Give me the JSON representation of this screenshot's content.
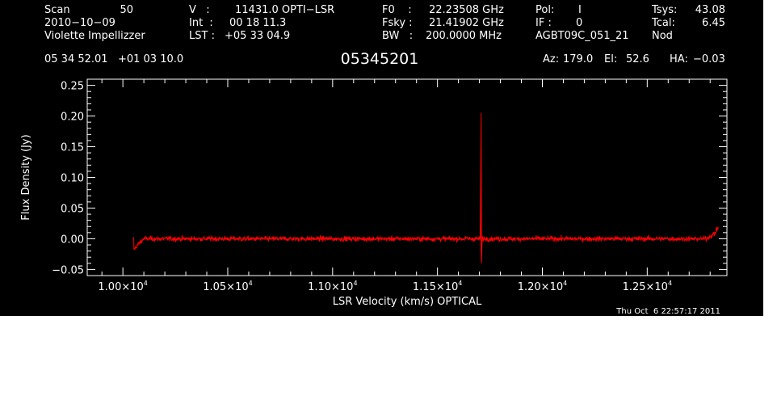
{
  "header": {
    "row1": {
      "scan_label": "Scan",
      "scan_value": "50",
      "v_label": "V   :",
      "v_value": "11431.0 OPTI−LSR",
      "f0_label": "F0    :",
      "f0_value": "22.23508 GHz",
      "pol_label": "Pol:",
      "pol_value": "I",
      "tsys_label": "Tsys:",
      "tsys_value": "43.08"
    },
    "row2": {
      "date": "2010−10−09",
      "int_label": "Int  :",
      "int_value": "00 18 11.3",
      "fsky_label": "Fsky :",
      "fsky_value": "21.41902 GHz",
      "if_label": "IF :",
      "if_value": "0",
      "tcal_label": "Tcal:",
      "tcal_value": "6.45"
    },
    "row3": {
      "observer": "Violette Impellizzer",
      "lst_label": "LST :",
      "lst_value": "+05 33 04.9",
      "bw_label": "BW   :",
      "bw_value": "200.0000 MHz",
      "project": "AGBT09C_051_21",
      "mode": "Nod"
    },
    "row4": {
      "coords": "05 34 52.01   +01 03 10.0",
      "source": "05345201",
      "az_label": "Az:",
      "az_value": "179.0",
      "el_label": "El:",
      "el_value": "52.6",
      "ha_label": "HA:",
      "ha_value": "−0.03"
    }
  },
  "timestamp": "Thu Oct  6 22:57:17 2011",
  "chart_data": {
    "type": "line",
    "xlabel": "LSR Velocity (km/s) OPTICAL",
    "ylabel": "Flux Density (Jy)",
    "xlim": [
      9830,
      12880
    ],
    "ylim": [
      -0.06,
      0.26
    ],
    "x_ticks": [
      {
        "mant": "1.00×10",
        "exp": "4",
        "v": 10000
      },
      {
        "mant": "1.05×10",
        "exp": "4",
        "v": 10500
      },
      {
        "mant": "1.10×10",
        "exp": "4",
        "v": 11000
      },
      {
        "mant": "1.15×10",
        "exp": "4",
        "v": 11500
      },
      {
        "mant": "1.20×10",
        "exp": "4",
        "v": 12000
      },
      {
        "mant": "1.25×10",
        "exp": "4",
        "v": 12500
      }
    ],
    "y_ticks": [
      {
        "label": "−0.05",
        "v": -0.05
      },
      {
        "label": "0.00",
        "v": 0.0
      },
      {
        "label": "0.05",
        "v": 0.05
      },
      {
        "label": "0.10",
        "v": 0.1
      },
      {
        "label": "0.15",
        "v": 0.15
      },
      {
        "label": "0.20",
        "v": 0.2
      },
      {
        "label": "0.25",
        "v": 0.25
      }
    ],
    "series": [
      {
        "color": "#ff0000",
        "x_range": [
          10050,
          12840
        ],
        "baseline": 0.0,
        "noise_rms": 0.004,
        "features": [
          {
            "x": 10052,
            "y": -0.018
          },
          {
            "x": 10070,
            "y": -0.01
          },
          {
            "x": 10100,
            "y": 0.0
          },
          {
            "x": 11705,
            "y": 0.0
          },
          {
            "x": 11708,
            "y": 0.205
          },
          {
            "x": 11710,
            "y": -0.04
          },
          {
            "x": 11713,
            "y": 0.0
          },
          {
            "x": 12780,
            "y": 0.0
          },
          {
            "x": 12820,
            "y": 0.008
          },
          {
            "x": 12840,
            "y": 0.02
          }
        ]
      }
    ]
  }
}
